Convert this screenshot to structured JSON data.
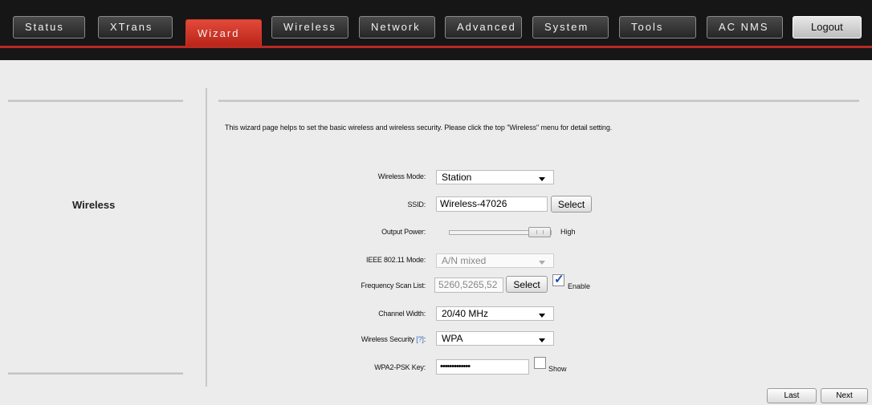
{
  "nav": {
    "tabs": [
      "Status",
      "XTrans",
      "Wizard",
      "Wireless",
      "Network",
      "Advanced",
      "System",
      "Tools",
      "AC NMS"
    ],
    "active": "Wizard",
    "logout": "Logout"
  },
  "side": {
    "title": "Wireless"
  },
  "intro": "This wizard page helps to set the basic wireless and wireless security. Please click the top \"Wireless\" menu for detail setting.",
  "form": {
    "wireless_mode": {
      "label": "Wireless Mode:",
      "value": "Station"
    },
    "ssid": {
      "label": "SSID:",
      "value": "Wireless-47026",
      "button": "Select"
    },
    "output_power": {
      "label": "Output Power:",
      "level_text": "High",
      "level": 1.0
    },
    "ieee_mode": {
      "label": "IEEE 802.11 Mode:",
      "value": "A/N mixed"
    },
    "freq_scan": {
      "label": "Frequency Scan List:",
      "value": "5260,5265,52",
      "button": "Select",
      "checkbox_label": "Enable",
      "checked": true
    },
    "channel_width": {
      "label": "Channel Width:",
      "value": "20/40 MHz"
    },
    "security": {
      "label": "Wireless Security",
      "help": "[?]",
      "colon": ":",
      "value": "WPA"
    },
    "psk": {
      "label": "WPA2-PSK Key:",
      "value": "•••••••••••••",
      "checkbox_label": "Show",
      "checked": false
    }
  },
  "buttons": {
    "last": "Last",
    "next": "Next"
  }
}
